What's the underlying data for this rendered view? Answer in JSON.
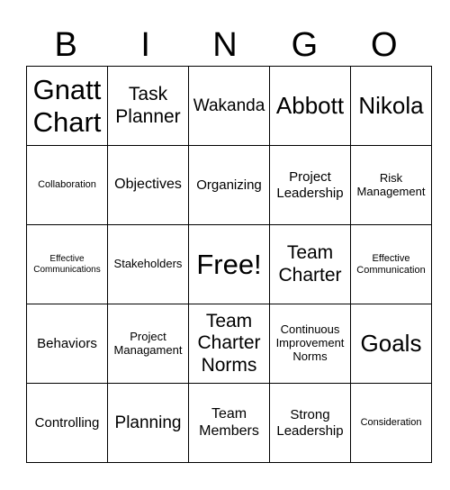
{
  "header": [
    "B",
    "I",
    "N",
    "G",
    "O"
  ],
  "grid": [
    [
      "Gnatt Chart",
      "Task Planner",
      "Wakanda",
      "Abbott",
      "Nikola"
    ],
    [
      "Collaboration",
      "Objectives",
      "Organizing",
      "Project Leadership",
      "Risk Management"
    ],
    [
      "Effective Communications",
      "Stakeholders",
      "Free!",
      "Team Charter",
      "Effective Communication"
    ],
    [
      "Behaviors",
      "Project Managament",
      "Team Charter Norms",
      "Continuous Improvement Norms",
      "Goals"
    ],
    [
      "Controlling",
      "Planning",
      "Team Members",
      "Strong Leadership",
      "Consideration"
    ]
  ]
}
